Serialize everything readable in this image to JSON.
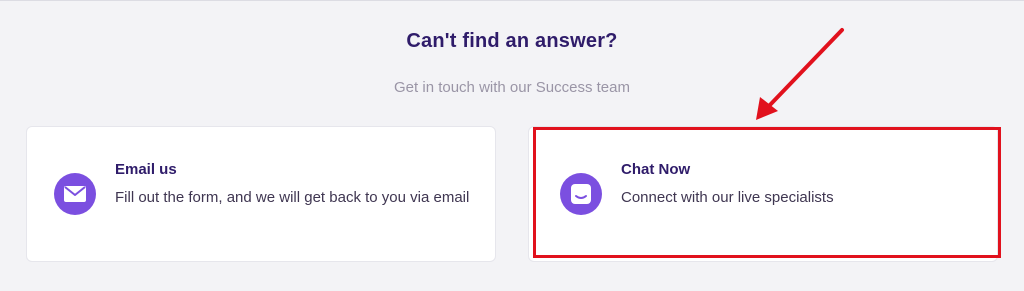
{
  "section": {
    "heading": "Can't find an answer?",
    "subheading": "Get in touch with our Success team"
  },
  "cards": [
    {
      "title": "Email us",
      "description": "Fill out the form, and we will get back to you via email",
      "icon": "mail-icon"
    },
    {
      "title": "Chat Now",
      "description": "Connect with our live specialists",
      "icon": "chat-icon"
    }
  ],
  "annotation": {
    "highlight_color": "#e1111d",
    "target": "Chat Now"
  },
  "colors": {
    "accent": "#7b4fe0",
    "heading": "#2f1c6a",
    "background": "#f3f3f6"
  }
}
